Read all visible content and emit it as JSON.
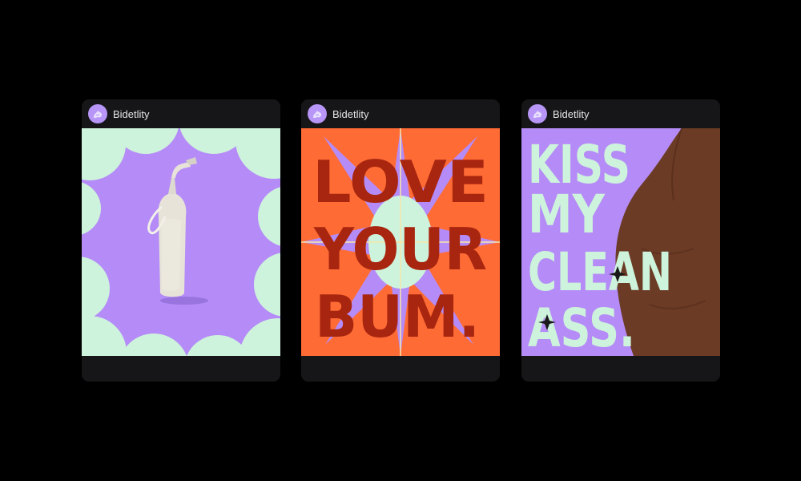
{
  "posts": [
    {
      "account": {
        "name": "Bidetlity",
        "avatar_icon": "bidet-logo-icon"
      },
      "media": {
        "type": "image",
        "subject": "bottle-icon"
      },
      "colors": {
        "background": "#b58cf7",
        "accent": "#cdf3dc"
      }
    },
    {
      "account": {
        "name": "Bidetlity",
        "avatar_icon": "bidet-logo-icon"
      },
      "media": {
        "type": "image",
        "headline": [
          "LOVE",
          "YOUR",
          "BUM."
        ]
      },
      "colors": {
        "background": "#ff6b35",
        "text": "#a8260f",
        "star": "#b58cf7",
        "center": "#cdf3dc"
      }
    },
    {
      "account": {
        "name": "Bidetlity",
        "avatar_icon": "bidet-logo-icon"
      },
      "media": {
        "type": "image",
        "headline": [
          "KISS",
          "MY",
          "CLEAN",
          "ASS."
        ]
      },
      "colors": {
        "background": "#b58cf7",
        "text": "#cdf3dc",
        "skin": "#6b3b25"
      }
    }
  ]
}
